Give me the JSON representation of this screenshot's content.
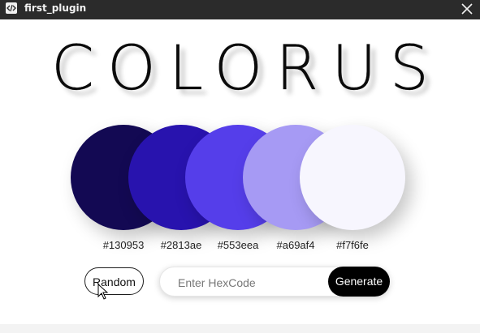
{
  "window": {
    "title": "first_plugin",
    "icon": "code-icon",
    "close_icon": "close-icon"
  },
  "app": {
    "logo_text": "COLORUS"
  },
  "palette": [
    {
      "hex": "#130953",
      "label": "#130953"
    },
    {
      "hex": "#2813ae",
      "label": "#2813ae"
    },
    {
      "hex": "#553eea",
      "label": "#553eea"
    },
    {
      "hex": "#a69af4",
      "label": "#a69af4"
    },
    {
      "hex": "#f7f6fe",
      "label": "#f7f6fe"
    }
  ],
  "controls": {
    "random_label": "Random",
    "input_placeholder": "Enter HexCode",
    "input_value": "",
    "generate_label": "Generate"
  }
}
